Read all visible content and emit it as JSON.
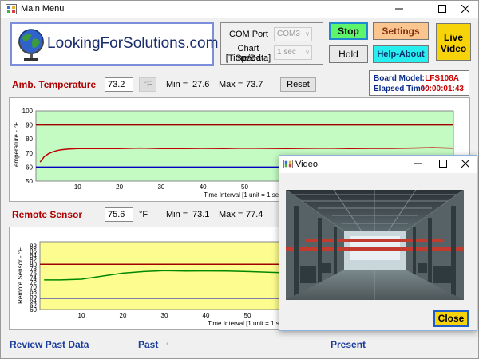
{
  "window": {
    "title": "Main Menu"
  },
  "logo": {
    "text": "LookingForSolutions.com"
  },
  "com": {
    "port_label": "COM Port",
    "port_value": "COM3",
    "speed_label_1": "Chart Speed",
    "speed_label_2": "[Time/Data]",
    "speed_value": "1 sec"
  },
  "buttons": {
    "stop": "Stop",
    "hold": "Hold",
    "settings": "Settings",
    "help": "Help-About",
    "live_1": "Live",
    "live_2": "Video",
    "reset": "Reset"
  },
  "board": {
    "model_label": "Board Model:",
    "model_value": "LFS108A",
    "elapsed_label": "Elapsed Time:",
    "elapsed_value": "00:00:01:43"
  },
  "amb": {
    "label": "Amb. Temperature",
    "value": "73.2",
    "unit": "°F",
    "min_label": "Min =",
    "min_value": "27.6",
    "max_label": "Max =",
    "max_value": "73.7"
  },
  "remote": {
    "label": "Remote Sensor",
    "value": "75.6",
    "unit": "°F",
    "min_label": "Min =",
    "min_value": "73.1",
    "max_label": "Max =",
    "max_value": "77.4"
  },
  "chart_data": [
    {
      "type": "line",
      "ylabel": "Temperature - °F",
      "xlabel": "Interval [1 unit = 1 sec]",
      "xlabel_visible": "Time Interval [1 unit = 1 seco",
      "ylim": [
        50,
        100
      ],
      "xlim": [
        0,
        100
      ],
      "yticks": [
        50,
        60,
        70,
        80,
        90,
        100
      ],
      "xticks": [
        10,
        20,
        30,
        40,
        50
      ],
      "background": "#c3fbc3",
      "series": [
        {
          "color": "#a00000",
          "x": [
            0,
            100
          ],
          "y": [
            90,
            90
          ]
        },
        {
          "color": "#0000c0",
          "x": [
            0,
            100
          ],
          "y": [
            60,
            60
          ]
        },
        {
          "color": "#c00000",
          "x": [
            1,
            2,
            3,
            4,
            5,
            6,
            8,
            10,
            15,
            20,
            25,
            30,
            35,
            40,
            45,
            50,
            55,
            60,
            65,
            70,
            75,
            80,
            85,
            90,
            95,
            100
          ],
          "y": [
            63.5,
            67.5,
            69.5,
            70.8,
            71.7,
            72.3,
            72.9,
            73.1,
            73.2,
            73.2,
            73.5,
            73.1,
            73.2,
            73.3,
            73.2,
            73.4,
            73.3,
            73.1,
            73.3,
            73.4,
            73.2,
            73.3,
            73.3,
            73.5,
            73.8,
            73.4
          ]
        }
      ]
    },
    {
      "type": "line",
      "ylabel": "Remote Sensor - °F",
      "xlabel": "Interval [1 unit = 1 sec]",
      "xlabel_visible": "Time Interval [1 unit = 1 seco",
      "ylim": [
        60,
        90
      ],
      "xlim": [
        0,
        100
      ],
      "yticks": [
        60,
        62,
        64,
        66,
        68,
        70,
        72,
        74,
        76,
        78,
        80,
        82,
        84,
        86,
        88
      ],
      "xticks": [
        10,
        20,
        30,
        40,
        50
      ],
      "background": "#fcfc8f",
      "series": [
        {
          "color": "#a00000",
          "x": [
            0,
            100
          ],
          "y": [
            80,
            80
          ]
        },
        {
          "color": "#0000c0",
          "x": [
            0,
            100
          ],
          "y": [
            65,
            65
          ]
        },
        {
          "color": "#008800",
          "x": [
            1,
            5,
            10,
            15,
            20,
            25,
            30,
            35,
            40,
            45,
            50,
            55,
            60,
            70,
            80,
            90,
            100
          ],
          "y": [
            73.1,
            73.1,
            73.4,
            74.8,
            76.1,
            76.8,
            77.2,
            77.0,
            77.1,
            77.0,
            76.8,
            76.5,
            76.2,
            76.0,
            75.8,
            75.7,
            75.6
          ]
        }
      ]
    }
  ],
  "bottom": {
    "review": "Review Past Data",
    "past": "Past",
    "present": "Present"
  },
  "video": {
    "title": "Video",
    "close": "Close"
  }
}
